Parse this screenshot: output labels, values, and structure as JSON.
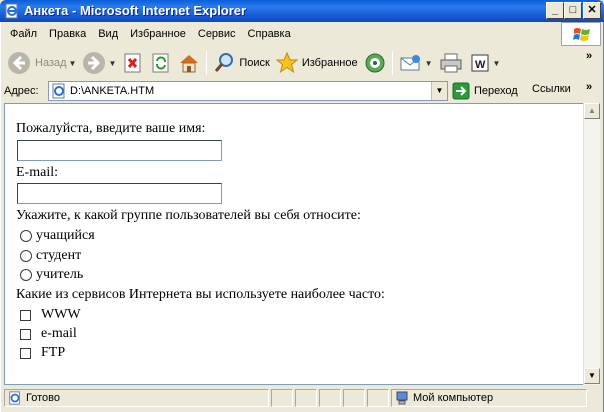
{
  "window": {
    "title": "Анкета - Microsoft Internet Explorer",
    "buttons": {
      "minimize": "_",
      "maximize": "□",
      "close": "✕"
    }
  },
  "menu": [
    "Файл",
    "Правка",
    "Вид",
    "Избранное",
    "Сервис",
    "Справка"
  ],
  "toolbar": {
    "back_label": "Назад",
    "search_label": "Поиск",
    "favorites_label": "Избранное",
    "overflow": "»"
  },
  "address": {
    "label": "Адрес:",
    "url": "D:\\ANKETA.HTM",
    "go_label": "Переход",
    "links_label": "Ссылки",
    "overflow": "»"
  },
  "form": {
    "name_prompt": "Пожалуйста, введите ваше имя:",
    "name_value": "",
    "email_prompt": "E-mail:",
    "email_value": "",
    "group_prompt": "Укажите, к какой группе пользователей вы себя относите:",
    "groups": [
      "учащийся",
      "студент",
      "учитель"
    ],
    "services_prompt": "Какие из сервисов Интернета вы используете наиболее часто:",
    "services": [
      "WWW",
      "e-mail",
      "FTP"
    ]
  },
  "status": {
    "text": "Готово",
    "zone": "Мой компьютер"
  },
  "colors": {
    "titlebar": "#0a5fd8",
    "chrome": "#ece9d8",
    "border": "#7f9db9"
  },
  "icons": [
    "ie-page-icon",
    "back-arrow-icon",
    "forward-arrow-icon",
    "stop-icon",
    "refresh-icon",
    "home-icon",
    "search-icon",
    "favorites-star-icon",
    "media-icon",
    "mail-icon",
    "print-icon",
    "edit-icon",
    "go-arrow-icon",
    "my-computer-icon",
    "windows-flag-icon"
  ]
}
